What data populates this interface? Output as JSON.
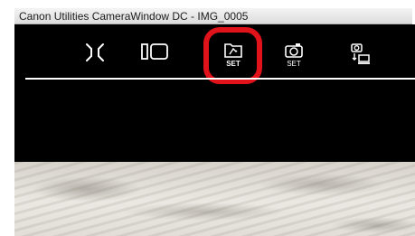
{
  "window": {
    "title": "Canon Utilities CameraWindow DC - IMG_0005"
  },
  "toolbar": {
    "buttons": [
      {
        "name": "fullscreen-icon",
        "label": ""
      },
      {
        "name": "panel-layout-icon",
        "label": ""
      },
      {
        "name": "folder-set-icon",
        "label": "SET",
        "highlighted": true
      },
      {
        "name": "camera-set-icon",
        "label": "SET"
      },
      {
        "name": "camera-transfer-icon",
        "label": ""
      }
    ]
  },
  "colors": {
    "toolbar_bg": "#000000",
    "highlight_ring": "#e0131b",
    "icon": "#ffffff"
  }
}
